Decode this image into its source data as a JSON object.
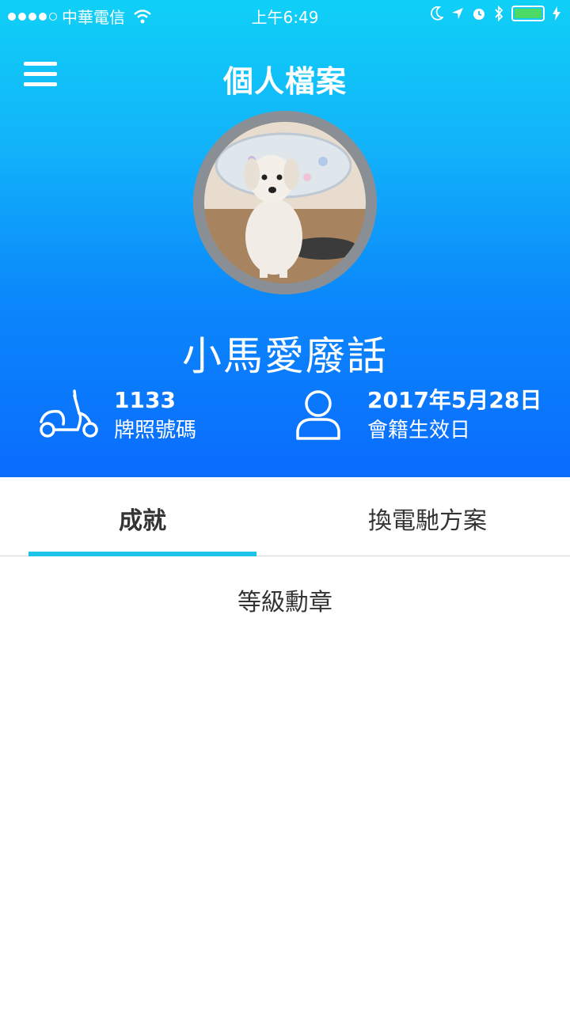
{
  "status_bar": {
    "carrier": "中華電信",
    "time": "上午6:49",
    "battery_color": "#4cd964"
  },
  "nav": {
    "title": "個人檔案",
    "menu_icon": "hamburger-menu-icon"
  },
  "profile": {
    "username": "小馬愛廢話",
    "avatar_alt": "dog-photo"
  },
  "info": {
    "plate": {
      "value": "1133",
      "label": "牌照號碼",
      "icon": "scooter-icon"
    },
    "membership": {
      "value": "2017年5月28日",
      "label": "會籍生效日",
      "icon": "person-icon"
    }
  },
  "tabs": [
    {
      "label": "成就",
      "active": true
    },
    {
      "label": "換電馳方案",
      "active": false
    }
  ],
  "content": {
    "section_title": "等級勳章"
  },
  "colors": {
    "header_top": "#0fd0f7",
    "header_bottom": "#0a6cfd",
    "tab_indicator": "#1ec3e8"
  }
}
